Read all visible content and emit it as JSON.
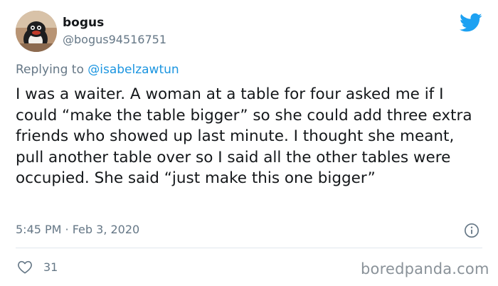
{
  "author": {
    "name": "bogus",
    "handle": "@bogus94516751"
  },
  "reply": {
    "prefix": "Replying to",
    "mention": "@isabelzawtun"
  },
  "tweet": {
    "text": "I was a waiter. A woman at a table for four asked me if I could “make the table bigger” so she could add three extra friends who showed up last minute. I thought she meant, pull another table over so I said all the other tables were occupied. She said “just make this one bigger”",
    "timestamp": "5:45 PM · Feb 3, 2020"
  },
  "actions": {
    "like_count": "31"
  },
  "watermark": "boredpanda.com",
  "icons": {
    "brand": "twitter-bird-icon",
    "info": "info-icon",
    "like": "heart-icon"
  },
  "colors": {
    "twitter_blue": "#1da1f2",
    "link_blue": "#1b95e0",
    "muted_gray": "#657786",
    "text": "#14171a"
  }
}
